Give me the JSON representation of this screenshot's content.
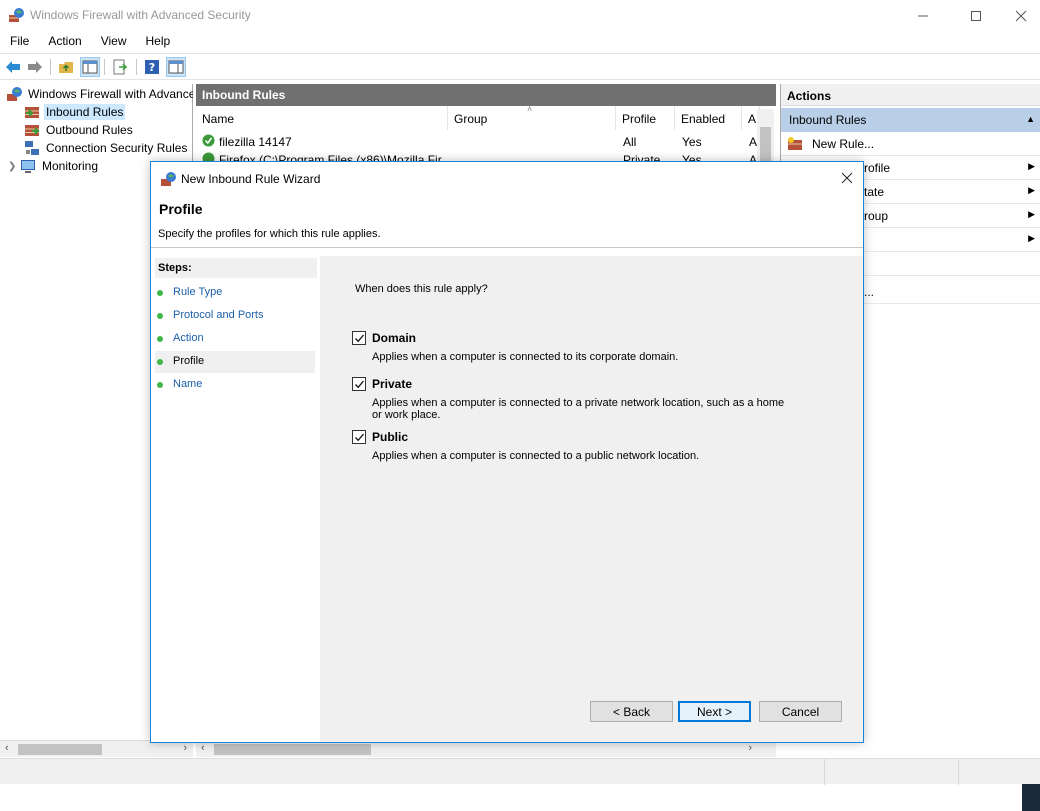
{
  "window": {
    "title": "Windows Firewall with Advanced Security",
    "controls": [
      "minimize-icon",
      "maximize-icon",
      "close-icon"
    ]
  },
  "menubar": [
    "File",
    "Action",
    "View",
    "Help"
  ],
  "tree": {
    "root": "Windows Firewall with Advance",
    "items": [
      {
        "label": "Inbound Rules",
        "icon": "inbound-rules-icon",
        "selected": true
      },
      {
        "label": "Outbound Rules",
        "icon": "outbound-rules-icon"
      },
      {
        "label": "Connection Security Rules",
        "icon": "connection-security-icon"
      },
      {
        "label": "Monitoring",
        "icon": "monitoring-icon"
      }
    ]
  },
  "center": {
    "header": "Inbound Rules",
    "columns": [
      "Name",
      "Group",
      "Profile",
      "Enabled",
      "A"
    ],
    "rows": [
      {
        "name": "filezilla 14147",
        "group": "",
        "profile": "All",
        "enabled": "Yes",
        "action": "A"
      },
      {
        "name": "Firefox (C:\\Program Files (x86)\\Mozilla Fir",
        "group": "",
        "profile": "Private",
        "enabled": "Yes",
        "action": "A"
      }
    ]
  },
  "actions": {
    "header": "Actions",
    "section": "Inbound Rules",
    "items": [
      {
        "label": "New Rule...",
        "icon": "new-rule-icon",
        "submenu": false
      },
      {
        "label": "rofile",
        "submenu": true
      },
      {
        "label": "tate",
        "submenu": true
      },
      {
        "label": "roup",
        "submenu": true
      },
      {
        "label": "",
        "submenu": true
      },
      {
        "label": "",
        "submenu": false
      },
      {
        "label": "...",
        "submenu": false
      }
    ]
  },
  "wizard": {
    "title": "New Inbound Rule Wizard",
    "heading": "Profile",
    "subheading": "Specify the profiles for which this rule applies.",
    "steps_label": "Steps:",
    "steps": [
      {
        "label": "Rule Type",
        "current": false
      },
      {
        "label": "Protocol and Ports",
        "current": false
      },
      {
        "label": "Action",
        "current": false
      },
      {
        "label": "Profile",
        "current": true
      },
      {
        "label": "Name",
        "current": false
      }
    ],
    "question": "When does this rule apply?",
    "options": [
      {
        "label": "Domain",
        "checked": true,
        "description": "Applies when a computer is connected to its corporate domain."
      },
      {
        "label": "Private",
        "checked": true,
        "description": "Applies when a computer is connected to a private network location, such as a home or work place."
      },
      {
        "label": "Public",
        "checked": true,
        "description": "Applies when a computer is connected to a public network location."
      }
    ],
    "buttons": {
      "back": "< Back",
      "next": "Next >",
      "cancel": "Cancel"
    }
  },
  "colors": {
    "accent": "#0078d7",
    "selection": "#cce8ff",
    "header_dark": "#707070",
    "actions_section": "#b8cfe7",
    "step_dot": "#42b549"
  }
}
